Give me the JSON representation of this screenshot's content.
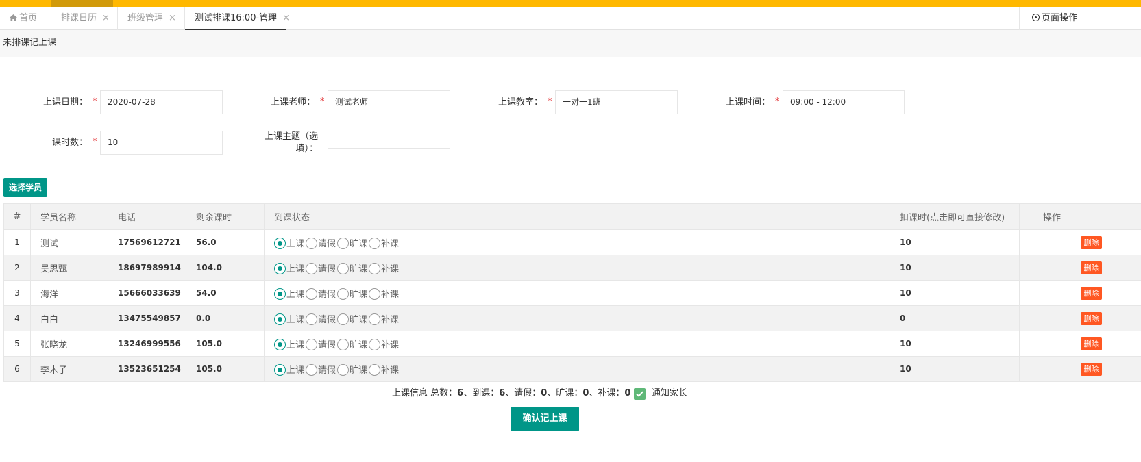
{
  "tabs": [
    {
      "label": "首页",
      "icon": "home-icon",
      "closable": false
    },
    {
      "label": "排课日历",
      "closable": true
    },
    {
      "label": "班级管理",
      "closable": true
    },
    {
      "label": "测试排课16:00-管理",
      "closable": true,
      "active": true
    }
  ],
  "tab_close": "×",
  "page_operation": "页面操作",
  "breadcrumb": "未排课记上课",
  "form": {
    "date_label": "上课日期：",
    "date_value": "2020-07-28",
    "teacher_label": "上课老师：",
    "teacher_value": "测试老师",
    "room_label": "上课教室：",
    "room_value": "一对一1班",
    "time_label": "上课时间：",
    "time_value": "09:00 - 12:00",
    "hours_label": "课时数：",
    "hours_value": "10",
    "topic_label_line1": "上课主题（选",
    "topic_label_line2": "填）：",
    "topic_value": "",
    "required_mark": "*"
  },
  "select_students_button": "选择学员",
  "table": {
    "headers": [
      "#",
      "学员名称",
      "电话",
      "剩余课时",
      "到课状态",
      "扣课时(点击即可直接修改)",
      "操作"
    ],
    "status_options": [
      "上课",
      "请假",
      "旷课",
      "补课"
    ],
    "delete_label": "删除",
    "rows": [
      {
        "idx": "1",
        "name": "测试",
        "phone": "17569612721",
        "remaining": "56.0",
        "status": "上课",
        "deduct": "10"
      },
      {
        "idx": "2",
        "name": "吴思甄",
        "phone": "18697989914",
        "remaining": "104.0",
        "status": "上课",
        "deduct": "10"
      },
      {
        "idx": "3",
        "name": "海洋",
        "phone": "15666033639",
        "remaining": "54.0",
        "status": "上课",
        "deduct": "10"
      },
      {
        "idx": "4",
        "name": "白白",
        "phone": "13475549857",
        "remaining": "0.0",
        "status": "上课",
        "deduct": "0"
      },
      {
        "idx": "5",
        "name": "张晓龙",
        "phone": "13246999556",
        "remaining": "105.0",
        "status": "上课",
        "deduct": "10"
      },
      {
        "idx": "6",
        "name": "李木子",
        "phone": "13523651254",
        "remaining": "105.0",
        "status": "上课",
        "deduct": "10"
      }
    ]
  },
  "summary": {
    "prefix": "上课信息 总数：",
    "total": "6",
    "attend_label": "、到课：",
    "attend": "6",
    "leave_label": "、请假：",
    "leave": "0",
    "absent_label": "、旷课：",
    "absent": "0",
    "makeup_label": "、补课：",
    "makeup": "0"
  },
  "notify_parents": {
    "label": "通知家长",
    "checked": true
  },
  "confirm_button": "确认记上课",
  "colors": {
    "primary": "#009688",
    "topbar": "#ffb800",
    "danger": "#ff5722",
    "checkbox": "#5fb878"
  }
}
